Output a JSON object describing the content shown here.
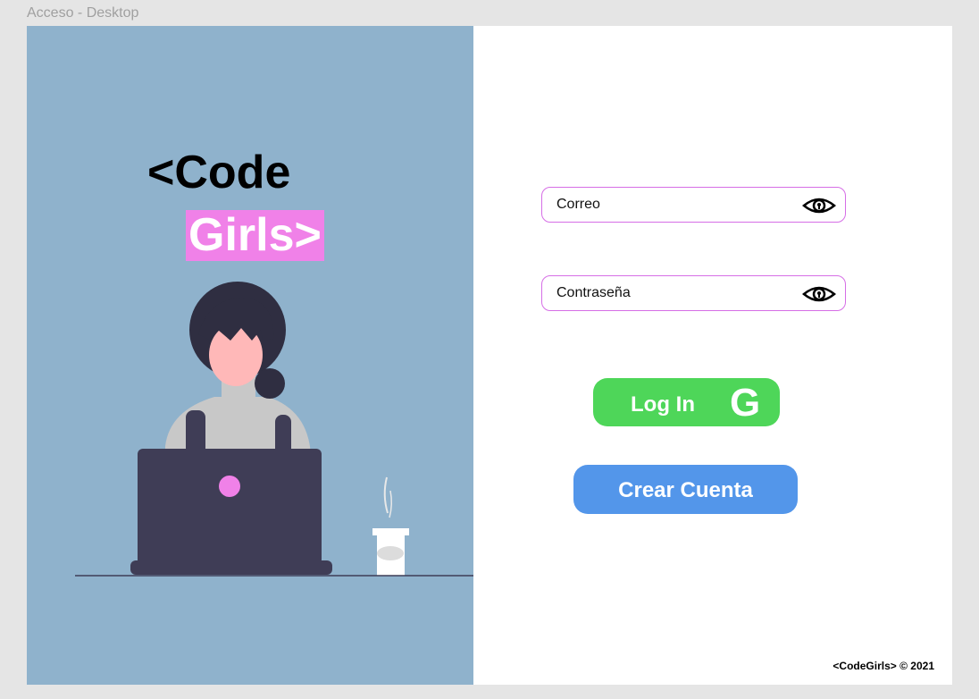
{
  "frame": {
    "label": "Acceso - Desktop"
  },
  "brand": {
    "line1": "<Code",
    "line2": "Girls>",
    "highlight_color": "#f081e8"
  },
  "form": {
    "email": {
      "placeholder": "Correo",
      "icon": "eye-icon"
    },
    "password": {
      "placeholder": "Contraseña",
      "icon": "eye-icon"
    },
    "login": {
      "label": "Log In",
      "google_letter": "G",
      "color": "#4ed659"
    },
    "create": {
      "label": "Crear Cuenta",
      "color": "#5396ea"
    }
  },
  "footer": {
    "text": "<CodeGirls> © 2021"
  },
  "colors": {
    "left_panel": "#8fb2cc",
    "field_border": "#d66ee6"
  }
}
